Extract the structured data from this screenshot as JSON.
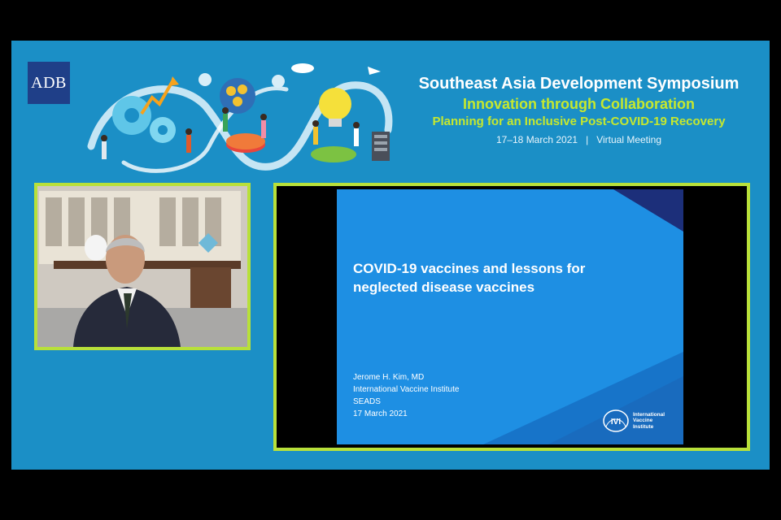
{
  "header": {
    "logo_text": "ADB",
    "title": "Southeast Asia Development Symposium",
    "subtitle": "Innovation through Collaboration",
    "tagline": "Planning for an Inclusive Post-COVID-19 Recovery",
    "dates": "17–18 March 2021",
    "separator": "|",
    "format": "Virtual Meeting",
    "illustration_icon": "collaboration-illustration"
  },
  "speaker": {
    "tile_label": "speaker-video"
  },
  "slide": {
    "title_line1": "COVID-19 vaccines and lessons for",
    "title_line2": "neglected disease vaccines",
    "presenter": "Jerome H. Kim, MD",
    "organization": "International Vaccine Institute",
    "event": "SEADS",
    "date": "17 March 2021",
    "logo_mark": "IVI",
    "logo_line1": "International",
    "logo_line2": "Vaccine",
    "logo_line3": "Institute"
  },
  "colors": {
    "background": "#1b8fc6",
    "accent_green": "#b8e03a",
    "slide_blue": "#1e8fe3",
    "adb_navy": "#1f3f88"
  }
}
